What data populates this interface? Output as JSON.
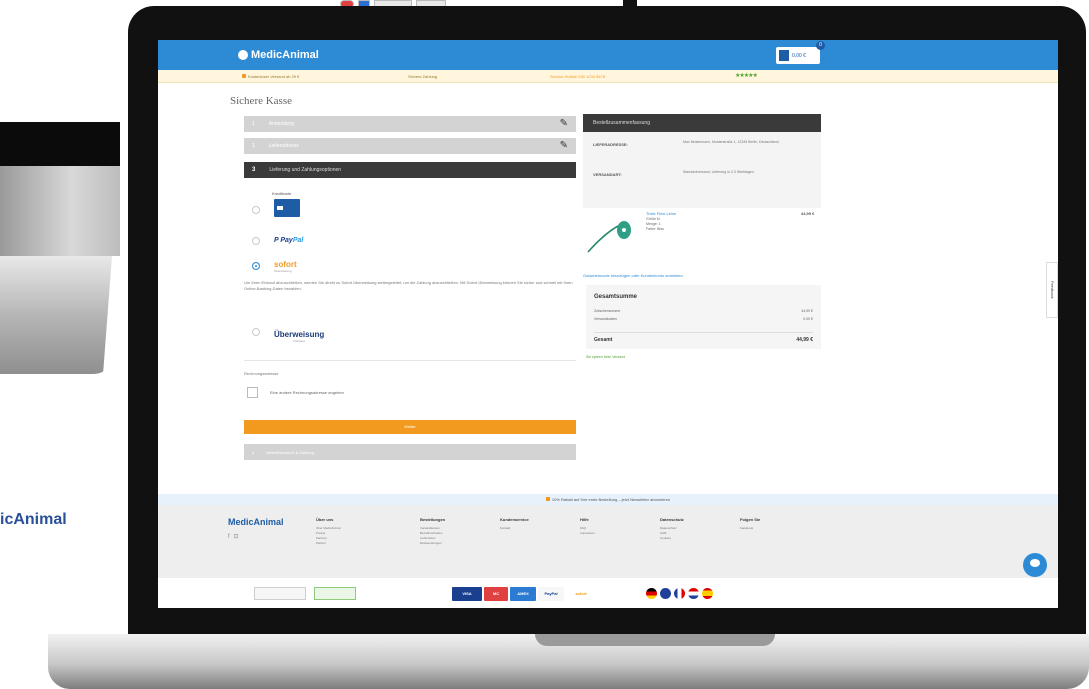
{
  "background": {
    "brand_text": "icAnimal"
  },
  "header": {
    "logo": "MedicAnimal",
    "cart_text": "0,00 €",
    "cart_count": "0"
  },
  "infobar": {
    "item1": "Kostenloser Versand ab 29 €",
    "item2": "Sichere Zahlung",
    "item3": "Service-Hotline 030 1234 5678",
    "rating": "★★★★★"
  },
  "page": {
    "title": "Sichere Kasse"
  },
  "steps": [
    {
      "num": "1",
      "label": "Anmeldung"
    },
    {
      "num": "1",
      "label": "Lieferadresse"
    },
    {
      "num": "3",
      "label": "Lieferung und Zahlungsoptionen"
    },
    {
      "num": "4",
      "label": "Bestellübersicht & Zahlung"
    }
  ],
  "payment": {
    "label": "Kreditkarte",
    "paypal_pay": "Pay",
    "paypal_pal": "Pal",
    "sofort": "sofort",
    "sofort_sub": "Überweisung",
    "description": "Um Ihren Einkauf abzuschließen, werden Sie direkt zu Sofort Überweisung weitergeleitet, um die Zahlung abzuschließen. Mit Sofort Überweisung können Sie sicher und schnell mit Ihren Online-Banking-Daten bezahlen.",
    "ueberweisung": "Überweisung",
    "ueberweisung_sub": "Vorkasse",
    "notes_label": "Rechnungsadresse",
    "check_label": "Eine andere Rechnungsadresse angeben",
    "button": "Weiter"
  },
  "summary": {
    "heading": "Bestellzusammenfassung",
    "delivery_key": "LIEFERADRESSE:",
    "delivery_val": "Max Mustermann, Musterstraße 1, 12345 Berlin, Deutschland",
    "shipping_key": "VERSANDART:",
    "shipping_val": "Standardversand, Lieferung in 2-3 Werktagen",
    "product_name": "Trixie Flexi-Leine",
    "product_meta": "Größe M\nMenge: 1\nFarbe: Blau",
    "product_price": "44,99 €",
    "coupon_link": "Gutscheincode hinzufügen oder Kundenkonto anmelden",
    "total_heading": "Gesamtsumme",
    "subtotal_label": "Zwischensumme",
    "subtotal_value": "44,99 €",
    "shipping_label": "Versandkosten",
    "shipping_value": "0,00 €",
    "grand_label": "Gesamt",
    "grand_value": "44,99 €",
    "ship_note": "Sie sparen beim Versand"
  },
  "side_tab": "Feedback",
  "promo": "10% Rabatt auf Ihre erste Bestellung – jetzt Newsletter abonnieren",
  "footer": {
    "logo": "MedicAnimal",
    "social": "f ⊡",
    "columns": [
      {
        "heading": "Über uns",
        "items": [
          "Über MedicAnimal",
          "Presse",
          "Karriere",
          "Partner"
        ]
      },
      {
        "heading": "Bestellungen",
        "items": [
          "Versandkosten",
          "Bezahlmethoden",
          "Lieferzeiten",
          "Rücksendungen"
        ]
      },
      {
        "heading": "Kundenservice",
        "items": [
          "Kontakt"
        ]
      },
      {
        "heading": "Hilfe",
        "items": [
          "FAQ",
          "Impressum"
        ]
      },
      {
        "heading": "Datenschutz",
        "items": [
          "Datenschutz",
          "AGB",
          "Cookies"
        ]
      },
      {
        "heading": "Folgen Sie",
        "items": [
          "Facebook"
        ]
      }
    ]
  },
  "payment_logos": [
    "VISA",
    "MC",
    "AMEX",
    "PayPal",
    "sofort"
  ],
  "colors": {
    "header_blue": "#2d8bd6",
    "orange": "#f29a1f",
    "dark": "#3a3a3a"
  }
}
